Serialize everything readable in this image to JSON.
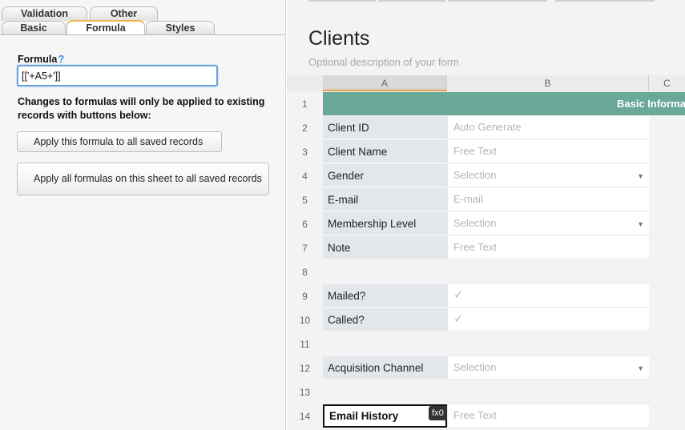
{
  "tabs": {
    "row1": [
      "Validation",
      "Other"
    ],
    "row2": [
      "Basic",
      "Formula",
      "Styles"
    ],
    "active": "Formula"
  },
  "formula": {
    "label": "Formula",
    "help": "?",
    "value": "[['+A5+']]"
  },
  "note": "Changes to formulas will only be applied to existing records with buttons below:",
  "buttons": {
    "apply_one": "Apply this formula to all saved records",
    "apply_all": "Apply all formulas on this sheet to all saved records"
  },
  "sheet": {
    "title": "Clients",
    "description": "Optional description of your form",
    "columns": [
      "A",
      "B",
      "C"
    ],
    "banner": "Basic Informa",
    "fx_badge": "fx0",
    "rows": [
      {
        "num": "1",
        "label": "",
        "value": "",
        "kind": "banner"
      },
      {
        "num": "2",
        "label": "Client ID",
        "value": "Auto Generate",
        "kind": "text"
      },
      {
        "num": "3",
        "label": "Client Name",
        "value": "Free Text",
        "kind": "text"
      },
      {
        "num": "4",
        "label": "Gender",
        "value": "Selection",
        "kind": "select"
      },
      {
        "num": "5",
        "label": "E-mail",
        "value": "E-mail",
        "kind": "text"
      },
      {
        "num": "6",
        "label": "Membership Level",
        "value": "Selection",
        "kind": "select"
      },
      {
        "num": "7",
        "label": "Note",
        "value": "Free Text",
        "kind": "text"
      },
      {
        "num": "8",
        "label": "",
        "value": "",
        "kind": "empty"
      },
      {
        "num": "9",
        "label": "Mailed?",
        "value": "✓",
        "kind": "check"
      },
      {
        "num": "10",
        "label": "Called?",
        "value": "✓",
        "kind": "check"
      },
      {
        "num": "11",
        "label": "",
        "value": "",
        "kind": "empty"
      },
      {
        "num": "12",
        "label": "Acquisition Channel",
        "value": "Selection",
        "kind": "select"
      },
      {
        "num": "13",
        "label": "",
        "value": "",
        "kind": "empty"
      },
      {
        "num": "14",
        "label": "Email History",
        "value": "Free Text",
        "kind": "text"
      }
    ]
  }
}
